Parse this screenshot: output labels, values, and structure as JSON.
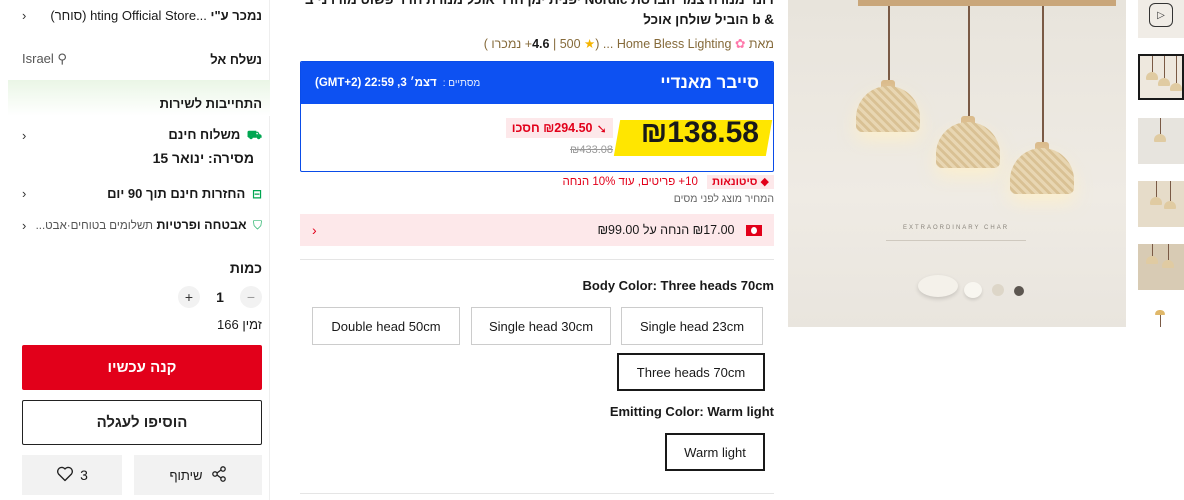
{
  "panel": {
    "store_prefix": "נמכר ע\"י",
    "store_name": "...hting Official Store",
    "store_suffix": "(סוחר)",
    "ship_to_label": "נשלח אל",
    "ship_to_value": "Israel",
    "service_title": "התחייבות לשירות",
    "free_shipping": "משלוח חינם",
    "delivery": "מסירה: ינואר 15",
    "free_returns": "החזרות חינם תוך 90 יום",
    "security_label": "אבטחה ופרטיות",
    "security_sub": "תשלומים בטוחים·אבט...",
    "quantity_label": "כמות",
    "quantity_value": "1",
    "minus": "−",
    "plus": "+",
    "available": "166 זמין",
    "buy_now": "קנה עכשיו",
    "add_to_cart": "הוסיפו לעגלה",
    "share": "שיתוף",
    "wishlist_count": "3"
  },
  "product": {
    "title_line1": "דונר מנורה צמר הברסת Nordic יפנית ימן חדר אוכל מנורת חדר פשוט מודרני ב",
    "title_line2": "& b הוביל שולחן אוכל",
    "seller_prefix": "מאת",
    "seller_name": "Home Bless Lighting ...",
    "rating": "4.6",
    "sold": "500+ נמכרו",
    "sale_name": "סייבר מאנדיי",
    "timer_label": "מסתיים :",
    "timer_value": "דצמ׳ 3, 22:59 (GMT+2)",
    "price": "₪138.58",
    "save": "₪294.50 חסכו",
    "old_price": "₪433.08",
    "bulk_badge": "סיטונאות",
    "bulk_text": "10+ פריטים, עוד 10% הנחה",
    "tax_note": "המחיר מוצג לפני מסים",
    "coupon": "₪17.00 הנחה על ₪99.00",
    "body_color_label": "Body Color: Three heads 70cm",
    "body_options": [
      "Double head 50cm",
      "Single head 30cm",
      "Single head 23cm",
      "Three heads 70cm"
    ],
    "emitting_label": "Emitting Color: Warm light",
    "emitting_options": [
      "Warm light"
    ]
  },
  "image": {
    "deco_text": "EXTRAORDINARY CHAR"
  },
  "icons": {
    "truck": "truck-icon",
    "return": "return-box-icon",
    "shield": "shield-check-icon",
    "location": "location-pin-icon",
    "share": "share-icon",
    "heart": "heart-icon",
    "play": "play-icon"
  },
  "colors": {
    "accent_red": "#e2001a",
    "sale_blue": "#0d51f2",
    "price_highlight": "#ffe600",
    "green": "#00a651"
  }
}
